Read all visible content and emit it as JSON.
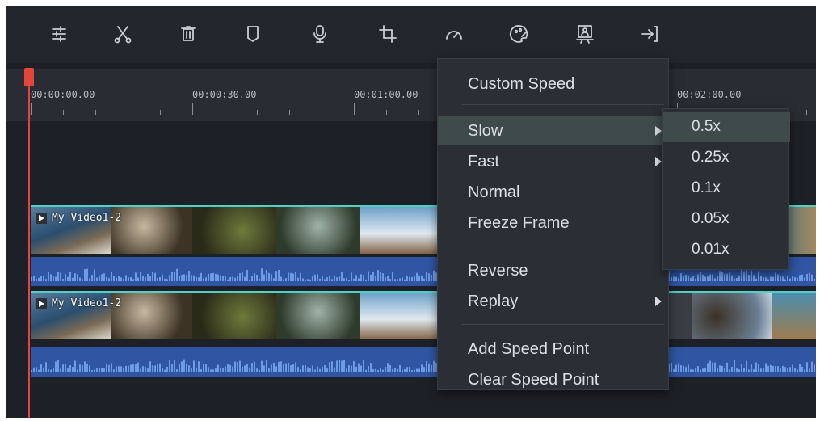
{
  "toolbar": {
    "tools": [
      {
        "icon": "adjust-sliders-icon"
      },
      {
        "icon": "scissors-icon"
      },
      {
        "icon": "trash-icon"
      },
      {
        "icon": "marker-icon"
      },
      {
        "icon": "microphone-icon"
      },
      {
        "icon": "crop-icon"
      },
      {
        "icon": "speed-gauge-icon"
      },
      {
        "icon": "color-palette-icon"
      },
      {
        "icon": "green-screen-icon"
      },
      {
        "icon": "export-arrow-icon"
      }
    ]
  },
  "ruler": {
    "timecodes": [
      "00:00:00.00",
      "00:00:30.00",
      "00:01:00.00",
      "00:02:00.00"
    ]
  },
  "tracks": [
    {
      "clip_title": "My Video1-2"
    },
    {
      "clip_title": "My Video1-2"
    }
  ],
  "speed_menu": {
    "items": [
      {
        "label": "Custom Speed",
        "submenu": false
      },
      {
        "label": "Slow",
        "submenu": true,
        "active": true
      },
      {
        "label": "Fast",
        "submenu": true
      },
      {
        "label": "Normal",
        "submenu": false
      },
      {
        "label": "Freeze Frame",
        "submenu": false
      },
      {
        "label": "Reverse",
        "submenu": false
      },
      {
        "label": "Replay",
        "submenu": true
      },
      {
        "label": "Add Speed Point",
        "submenu": false
      },
      {
        "label": "Clear Speed Point",
        "submenu": false
      }
    ]
  },
  "slow_submenu": {
    "items": [
      "0.5x",
      "0.25x",
      "0.1x",
      "0.05x",
      "0.01x"
    ]
  },
  "colors": {
    "background": "#1e2027",
    "toolbar": "#24262d",
    "menu": "#2b2e35",
    "menu_hover": "#3f4a4b",
    "playhead": "#e0463c",
    "audio": "#2f55a3",
    "audio_wave": "#6f9be6",
    "clip_border": "#4fd1c8"
  }
}
